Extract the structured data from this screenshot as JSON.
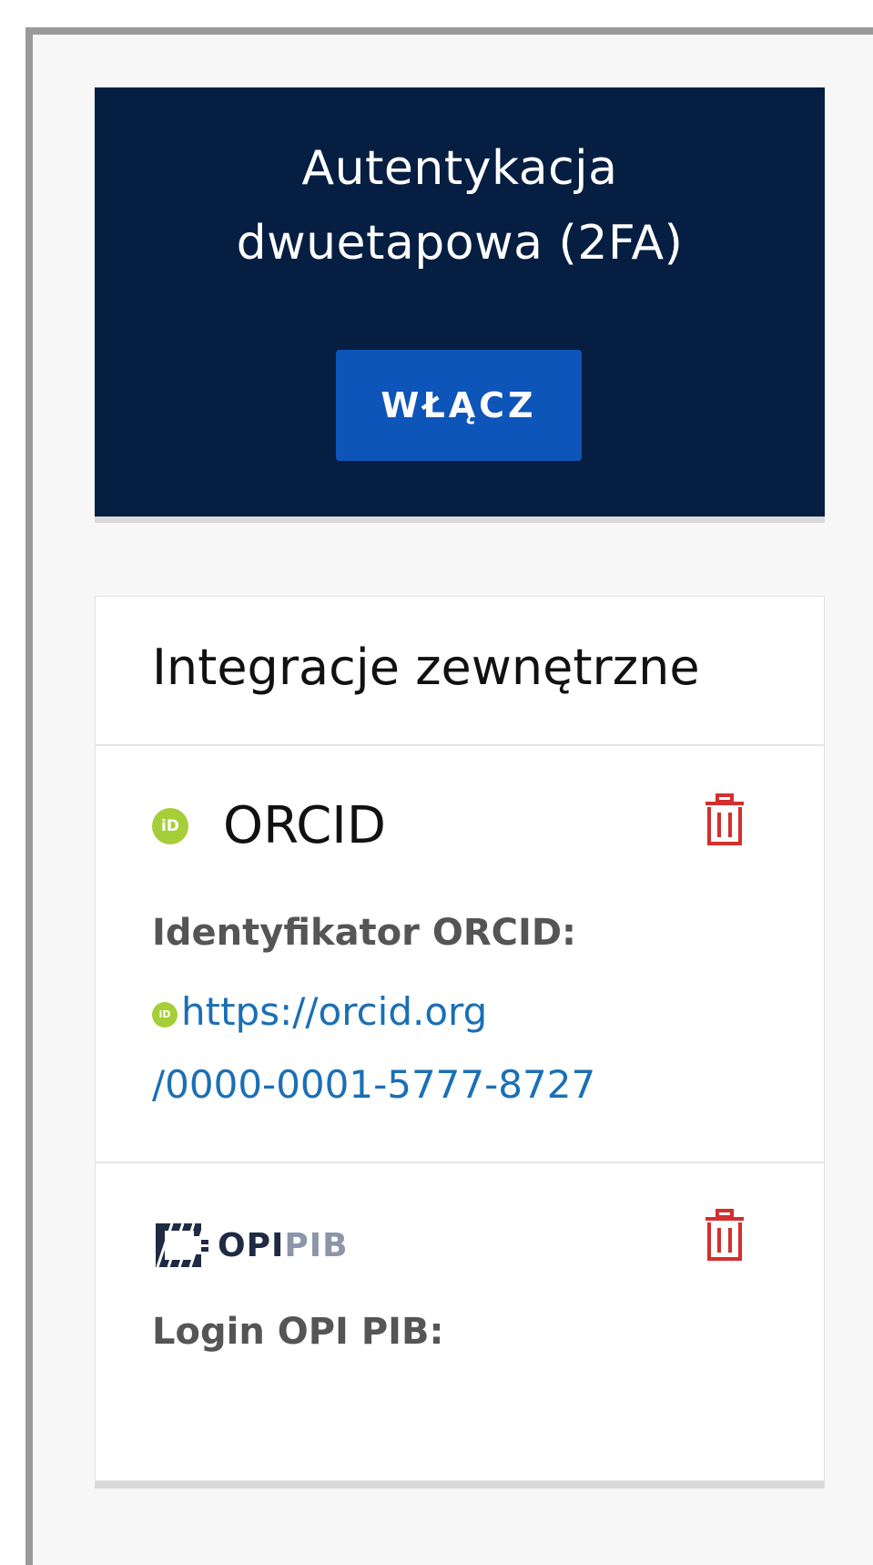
{
  "two_factor": {
    "title_line1": "Autentykacja",
    "title_line2": "dwuetapowa (2FA)",
    "enable_label": "WŁĄCZ"
  },
  "integrations": {
    "title": "Integracje zewnętrzne",
    "orcid": {
      "badge": "iD",
      "name": "ORCID",
      "id_label": "Identyfikator ORCID:",
      "link_text_line1": "https://orcid.org",
      "link_text_line2": "/0000-0001-5777-8727"
    },
    "opi": {
      "logo_text_opi": "OPI",
      "logo_text_pib": "PIB",
      "login_label": "Login OPI PIB:",
      "login_value": ""
    }
  },
  "colors": {
    "tfa_background": "#061e42",
    "tfa_button": "#0d55b8",
    "orcid_green": "#a6ce39",
    "link_blue": "#1a6fb5",
    "delete_red": "#d32f2f"
  },
  "icons": {
    "orcid": "orcid-icon",
    "delete": "trash-icon",
    "opi_logo": "opi-pib-logo"
  }
}
